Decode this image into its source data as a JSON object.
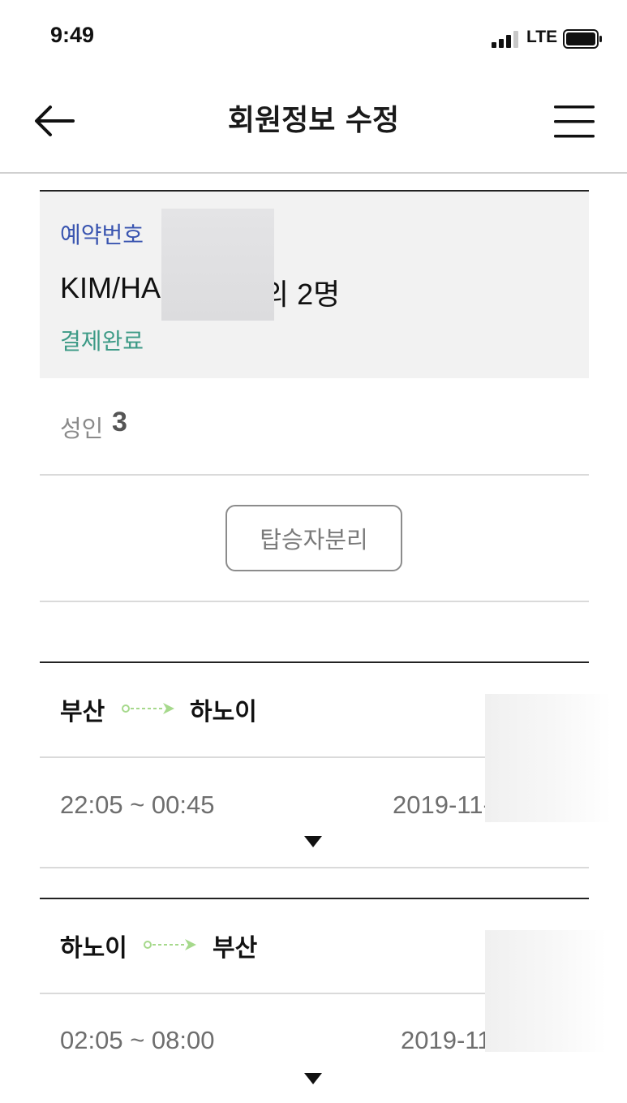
{
  "status_bar": {
    "time": "9:49",
    "network": "LTE"
  },
  "header": {
    "title": "회원정보 수정"
  },
  "reservation": {
    "label": "예약번호",
    "passenger_name_visible": "KIM/HA",
    "passenger_suffix": "외 2명",
    "payment_status": "결제완료"
  },
  "passengers": {
    "adult_label": "성인",
    "adult_count": "3"
  },
  "actions": {
    "split_passengers_label": "탑승자분리"
  },
  "flights": [
    {
      "origin": "부산",
      "destination": "하노이",
      "time": "22:05 ~ 00:45",
      "date_visible": "2019-11-"
    },
    {
      "origin": "하노이",
      "destination": "부산",
      "time": "02:05 ~ 08:00",
      "date_visible": "2019-11"
    }
  ],
  "colors": {
    "reservation_label": "#3a55b0",
    "payment_status": "#3c9a86",
    "route_arrow": "#a6d98c",
    "card_background": "#f2f2f2"
  },
  "icons": {
    "back": "arrow-left",
    "menu": "hamburger",
    "expand": "caret-down",
    "route": "route-arrow"
  }
}
